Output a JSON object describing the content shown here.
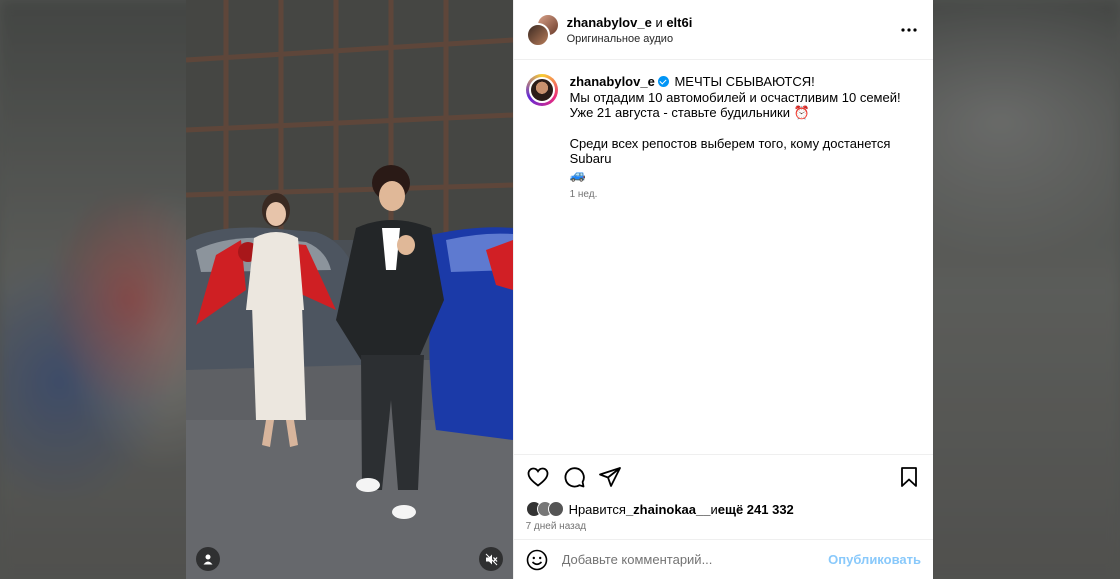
{
  "header": {
    "user1": "zhanabylov_e",
    "conjunction": " и ",
    "user2": "elt6i",
    "audio": "Оригинальное аудио"
  },
  "caption": {
    "username": "zhanabylov_e",
    "line1": "МЕЧТЫ СБЫВАЮТСЯ!",
    "line2": "Мы отдадим 10 автомобилей и осчастливим 10 семей!",
    "line3": "Уже 21 августа - ставьте будильники ⏰",
    "line4": "Среди всех репостов выберем того, кому достанется Subaru",
    "line5": "🚙",
    "time": "1 нед."
  },
  "likes": {
    "prefix": "Нравится ",
    "user": "_zhainokaa__",
    "mid": " и ",
    "count": "ещё 241 332"
  },
  "posted": "7 дней назад",
  "comment": {
    "placeholder": "Добавьте комментарий...",
    "publish": "Опубликовать"
  },
  "colors": {
    "accent": "#0095f6",
    "publish_disabled": "#89c9fb"
  },
  "icons": [
    "more-icon",
    "heart-icon",
    "comment-icon",
    "share-icon",
    "bookmark-icon",
    "emoji-icon",
    "user-icon",
    "mute-icon",
    "verified-icon"
  ]
}
